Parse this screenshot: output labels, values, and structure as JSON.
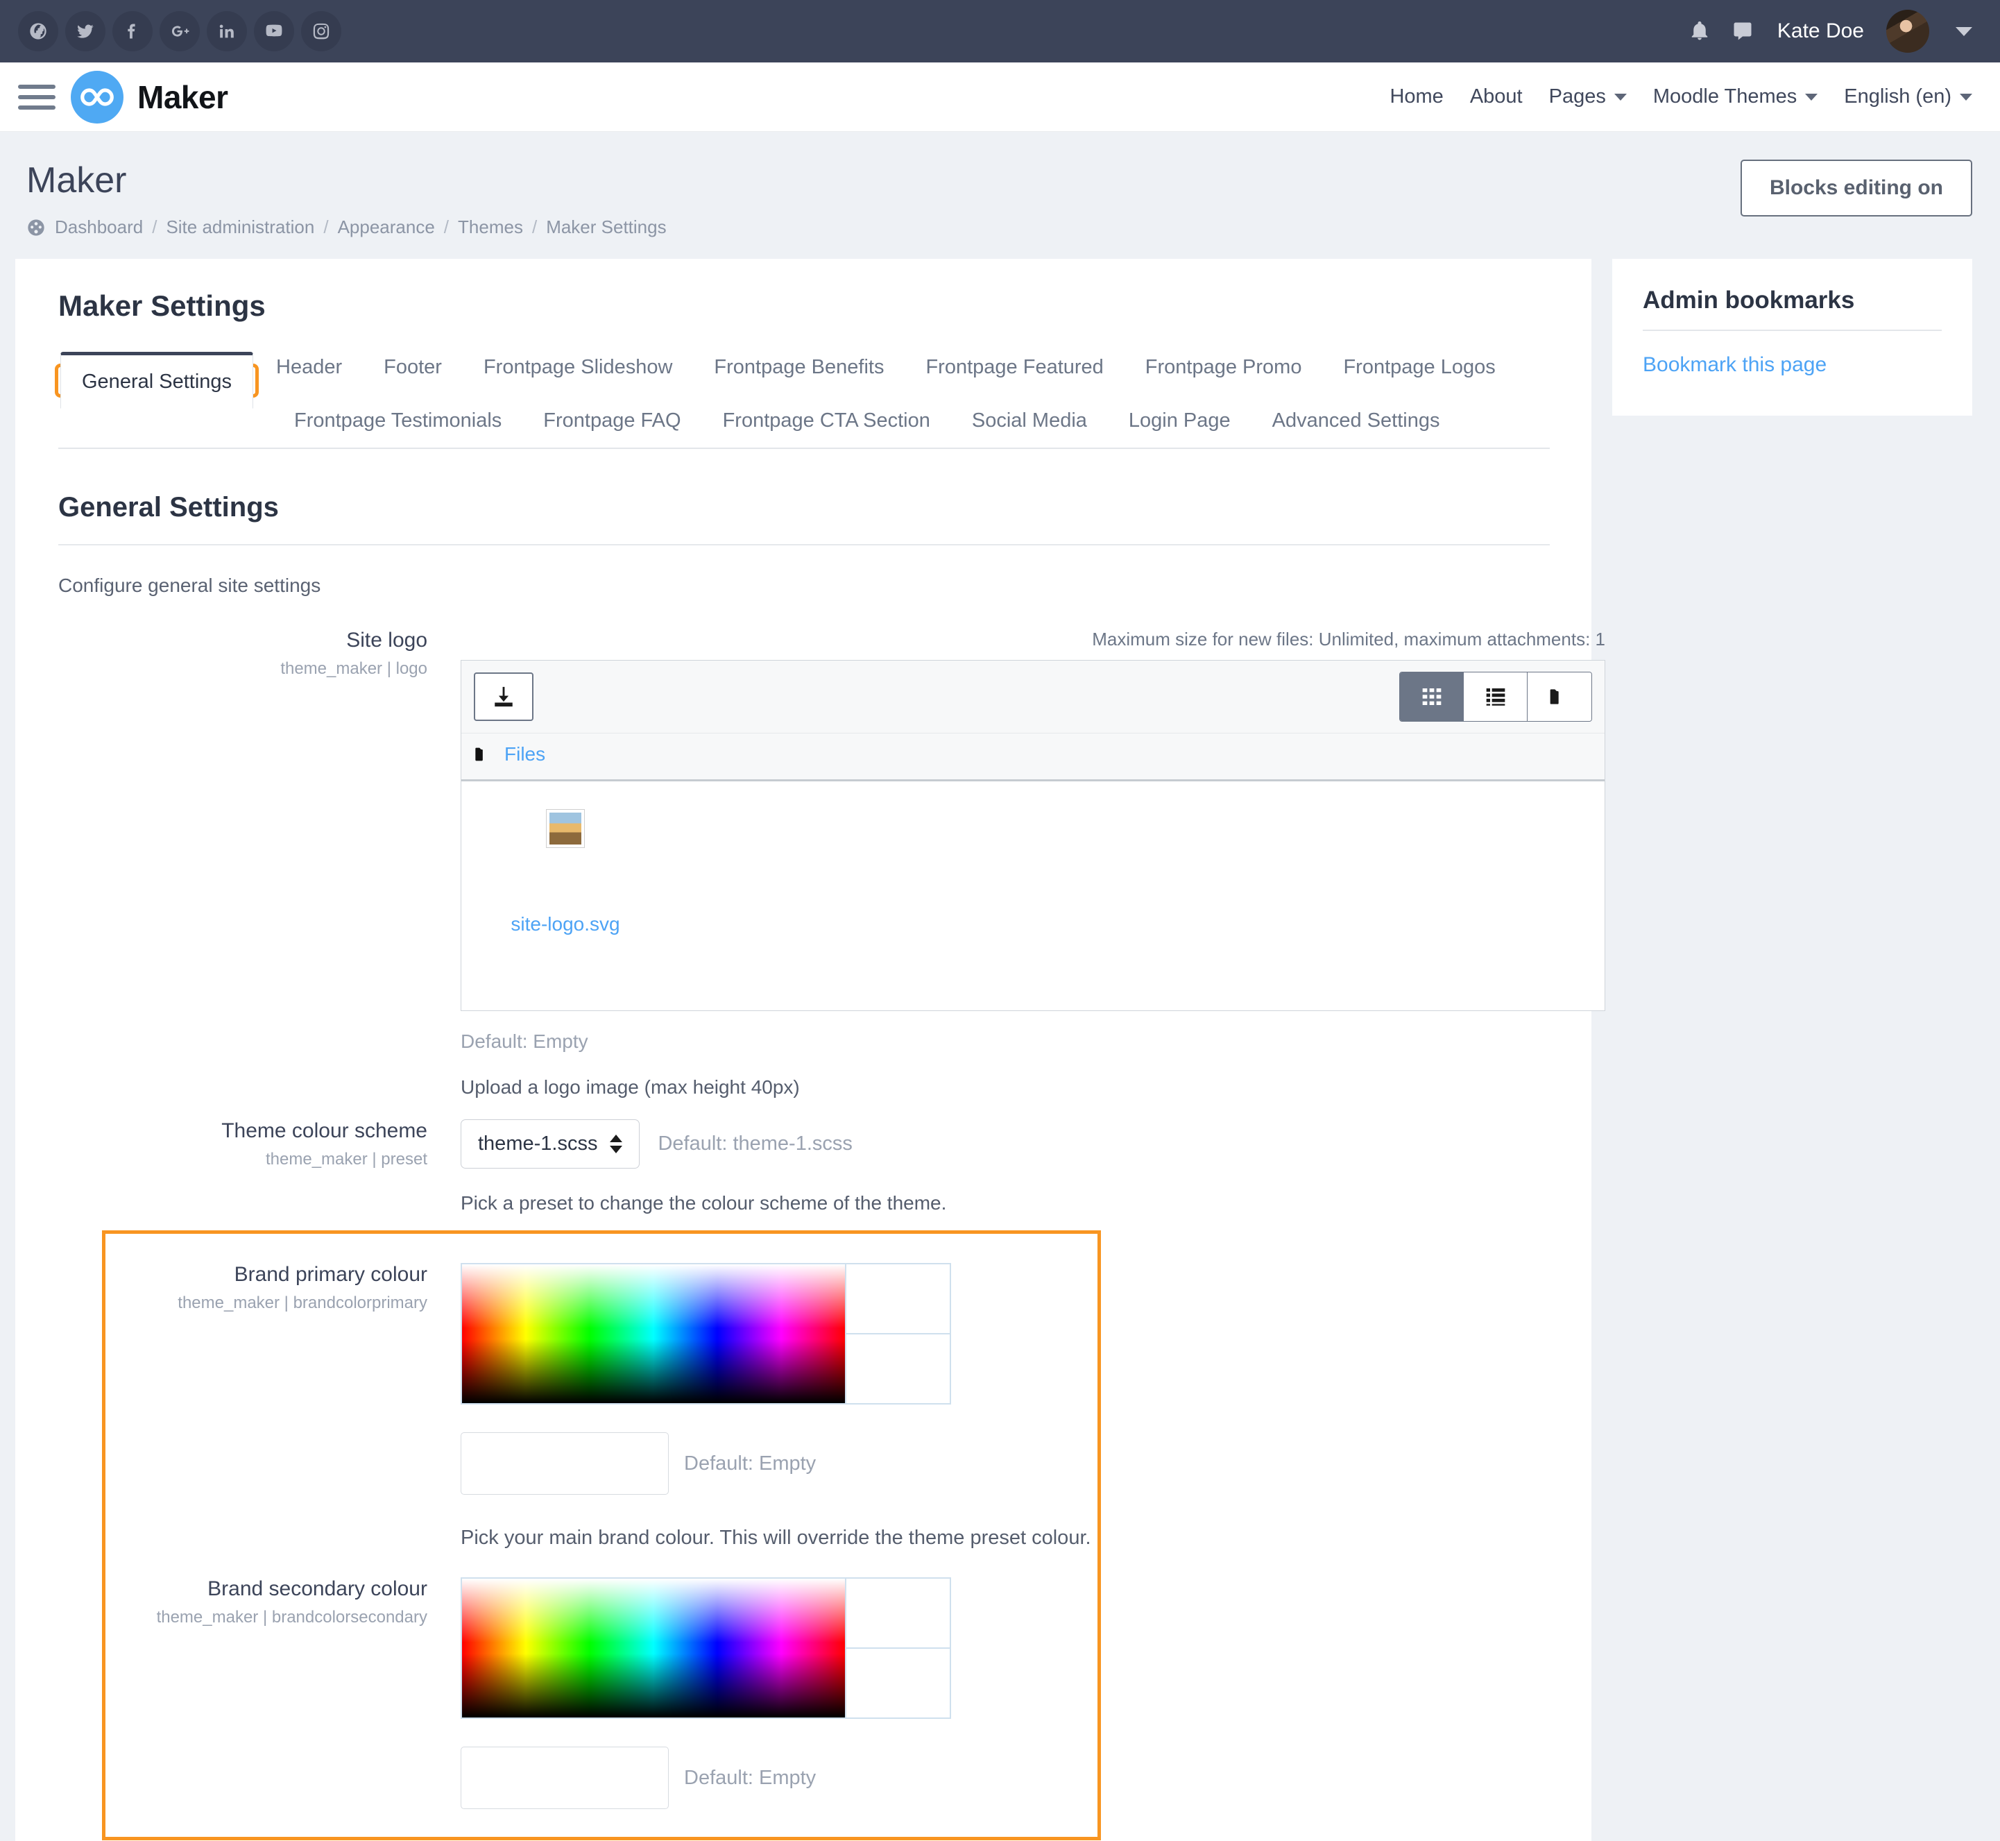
{
  "topbar": {
    "social": [
      {
        "name": "globe-icon",
        "label": "Website"
      },
      {
        "name": "twitter-icon",
        "label": "Twitter"
      },
      {
        "name": "facebook-icon",
        "label": "Facebook"
      },
      {
        "name": "google-plus-icon",
        "label": "Google Plus"
      },
      {
        "name": "linkedin-icon",
        "label": "LinkedIn"
      },
      {
        "name": "youtube-icon",
        "label": "YouTube"
      },
      {
        "name": "instagram-icon",
        "label": "Instagram"
      }
    ],
    "notifications_icon": "bell-icon",
    "messages_icon": "chat-bubble-icon",
    "user_name": "Kate Doe"
  },
  "navbar": {
    "brand": "Maker",
    "links": [
      {
        "label": "Home",
        "has_caret": false
      },
      {
        "label": "About",
        "has_caret": false
      },
      {
        "label": "Pages",
        "has_caret": true
      },
      {
        "label": "Moodle Themes",
        "has_caret": true
      },
      {
        "label": "English (en)",
        "has_caret": true
      }
    ]
  },
  "page": {
    "title": "Maker",
    "breadcrumb": [
      "Dashboard",
      "Site administration",
      "Appearance",
      "Themes",
      "Maker Settings"
    ],
    "blocks_button": "Blocks editing on"
  },
  "settings": {
    "heading": "Maker Settings",
    "tabs_row1": [
      "General Settings",
      "Header",
      "Footer",
      "Frontpage Slideshow",
      "Frontpage Benefits",
      "Frontpage Featured",
      "Frontpage Promo",
      "Frontpage Logos"
    ],
    "tabs_row2": [
      "Frontpage Testimonials",
      "Frontpage FAQ",
      "Frontpage CTA Section",
      "Social Media",
      "Login Page",
      "Advanced Settings"
    ],
    "active_tab": "General Settings",
    "section_title": "General Settings",
    "section_desc": "Configure general site settings"
  },
  "site_logo": {
    "label": "Site logo",
    "sublabel": "theme_maker | logo",
    "max_size_note": "Maximum size for new files: Unlimited, maximum attachments: 1",
    "add_file_icon": "upload-file-icon",
    "views": [
      {
        "name": "grid-view-icon",
        "active": true
      },
      {
        "name": "list-view-icon",
        "active": false
      },
      {
        "name": "tree-view-icon",
        "active": false
      }
    ],
    "breadcrumb_label": "Files",
    "file_name": "site-logo.svg",
    "default_text": "Default: Empty",
    "help_text": "Upload a logo image (max height 40px)"
  },
  "theme_scheme": {
    "label": "Theme colour scheme",
    "sublabel": "theme_maker | preset",
    "value": "theme-1.scss",
    "options": [
      "theme-1.scss"
    ],
    "default_text": "Default: theme-1.scss",
    "help_text": "Pick a preset to change the colour scheme of the theme."
  },
  "brand_primary": {
    "label": "Brand primary colour",
    "sublabel": "theme_maker | brandcolorprimary",
    "value": "",
    "default_text": "Default: Empty",
    "help_text": "Pick your main brand colour. This will override the theme preset colour."
  },
  "brand_secondary": {
    "label": "Brand secondary colour",
    "sublabel": "theme_maker | brandcolorsecondary",
    "value": "",
    "default_text": "Default: Empty"
  },
  "rail": {
    "block_title": "Admin bookmarks",
    "bookmark_link": "Bookmark this page"
  },
  "colors": {
    "topbar_bg": "#3c4459",
    "brand_blue": "#4fa9f3",
    "link_blue": "#4da3f5",
    "highlight_orange": "#f89521",
    "page_bg": "#eef1f5",
    "muted_text": "#9aa2b0"
  }
}
